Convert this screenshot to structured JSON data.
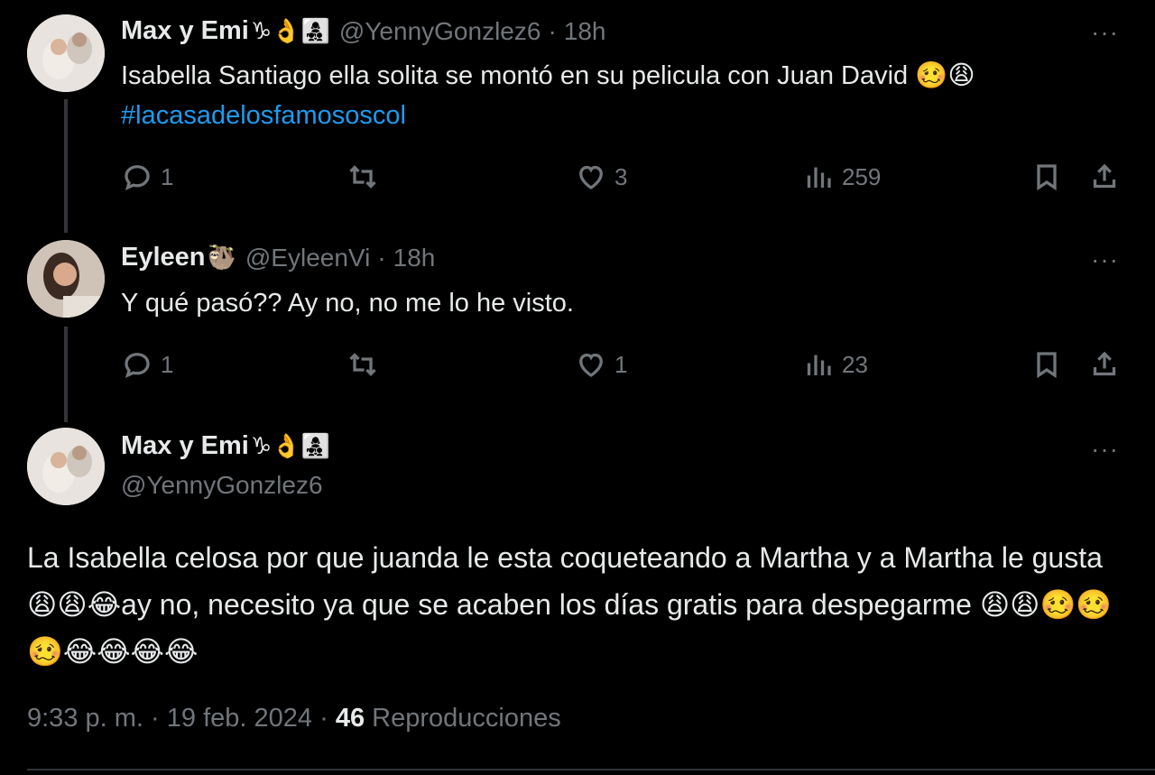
{
  "tweets": [
    {
      "display_name": "Max y Emi",
      "emojis": "♑👌👩‍👧‍👦",
      "handle": "@YennyGonzlez6",
      "separator": "·",
      "time": "18h",
      "text": "Isabella Santiago ella solita se montó en su pelicula con Juan David 🥴😩",
      "hashtag": "#lacasadelosfamososcol",
      "replies": "1",
      "retweets": "",
      "likes": "3",
      "views": "259"
    },
    {
      "display_name": "Eyleen",
      "emojis": "🦥",
      "handle": "@EyleenVi",
      "separator": "·",
      "time": "18h",
      "text": "Y qué pasó?? Ay no, no me lo he visto.",
      "replies": "1",
      "retweets": "",
      "likes": "1",
      "views": "23"
    }
  ],
  "main_tweet": {
    "display_name": "Max y Emi",
    "emojis": "♑👌👩‍👧‍👦",
    "handle": "@YennyGonzlez6",
    "text": "La Isabella celosa por que juanda le esta coqueteando a Martha y a Martha le gusta  😩😩😂ay no, necesito ya que se acaben los días gratis para despegarme 😩😩🥴🥴🥴😂😂😂😂",
    "time": "9:33 p. m.",
    "separator1": "·",
    "date": "19 feb. 2024",
    "separator2": "·",
    "views_count": "46",
    "views_label": "Reproducciones"
  },
  "more_label": "···",
  "colors": {
    "background": "#000000",
    "text": "#e7e9ea",
    "muted": "#71767b",
    "link": "#1d9bf0"
  }
}
